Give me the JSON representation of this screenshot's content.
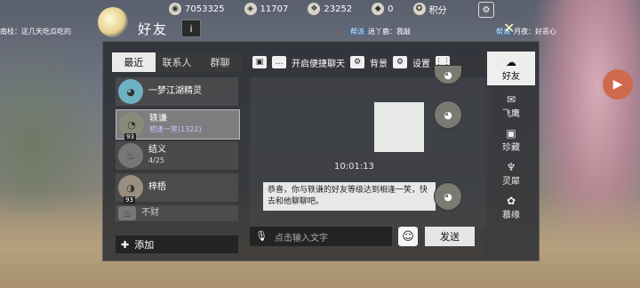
{
  "resources": [
    {
      "icon": "copper-coin-icon",
      "glyph": "◉",
      "value": "7053325"
    },
    {
      "icon": "silver-ingot-icon",
      "glyph": "◈",
      "value": "11707"
    },
    {
      "icon": "jade-icon",
      "glyph": "❖",
      "value": "23252"
    },
    {
      "icon": "gold-ingot-icon",
      "glyph": "◆",
      "value": "0"
    },
    {
      "icon": "points-icon",
      "glyph": "✪",
      "value": "积分"
    }
  ],
  "ticker": {
    "left": "南枝：这几天吃瓜吃的",
    "mid_tag": "帮派",
    "mid": "迷丫鹿：我敲",
    "right_tag": "帮派",
    "right": "月夜：好恶心"
  },
  "header": {
    "title": "好友",
    "info_label": "i"
  },
  "tabs": [
    {
      "label": "最近",
      "active": true
    },
    {
      "label": "联系人",
      "active": false
    },
    {
      "label": "群聊",
      "active": false
    }
  ],
  "friends": [
    {
      "name": "一梦江湖精灵",
      "sub": "",
      "level": "",
      "selected": false
    },
    {
      "name": "轶谦",
      "sub": "相逢一笑(1322)",
      "level": "93",
      "selected": true
    },
    {
      "name": "结义",
      "sub": "4/25",
      "level": "",
      "selected": false
    },
    {
      "name": "梓梧",
      "sub": "",
      "level": "93",
      "selected": false
    },
    {
      "name": "不财",
      "sub": "",
      "level": "",
      "selected": false
    }
  ],
  "add_label": "添加",
  "toolbar": {
    "quick_chat": "开启便捷聊天",
    "background": "背景",
    "settings": "设置"
  },
  "chat": {
    "time": "10:01:13",
    "system_message": "恭喜，你与轶谦的好友等级达到相逢一笑，快去和他聊聊吧。"
  },
  "input": {
    "placeholder": "点击输入文字"
  },
  "send_label": "发送",
  "side_nav": [
    {
      "label": "好友",
      "icon": "friends-icon",
      "glyph": "☁",
      "active": true
    },
    {
      "label": "飞鹰",
      "icon": "eagle-icon",
      "glyph": "✉",
      "active": false
    },
    {
      "label": "珍藏",
      "icon": "collection-icon",
      "glyph": "▣",
      "active": false
    },
    {
      "label": "灵犀",
      "icon": "lingxi-icon",
      "glyph": "♆",
      "active": false
    },
    {
      "label": "慕缘",
      "icon": "muyuan-icon",
      "glyph": "✿",
      "active": false
    }
  ]
}
